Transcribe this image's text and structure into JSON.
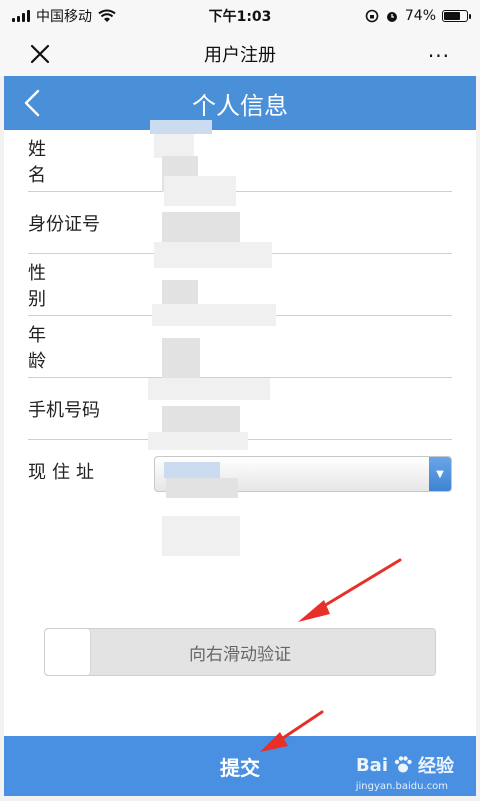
{
  "status_bar": {
    "carrier": "中国移动",
    "time": "下午1:03",
    "battery_percent": "74%",
    "battery_level": 0.74
  },
  "nav": {
    "title": "用户注册",
    "more": "···"
  },
  "header": {
    "title": "个人信息"
  },
  "form": {
    "rows": [
      {
        "label": "姓　名"
      },
      {
        "label": "身份证号"
      },
      {
        "label": "性　别"
      },
      {
        "label": "年　龄"
      },
      {
        "label": "手机号码"
      },
      {
        "label": "现住址"
      }
    ]
  },
  "slider": {
    "label": "向右滑动验证"
  },
  "submit": {
    "label": "提交"
  },
  "watermark": {
    "brand": "Bai",
    "brand_suffix": "经验",
    "url": "jingyan.baidu.com"
  },
  "colors": {
    "primary": "#4a90e2",
    "header": "#4a90d9",
    "arrow": "#e8302a"
  }
}
